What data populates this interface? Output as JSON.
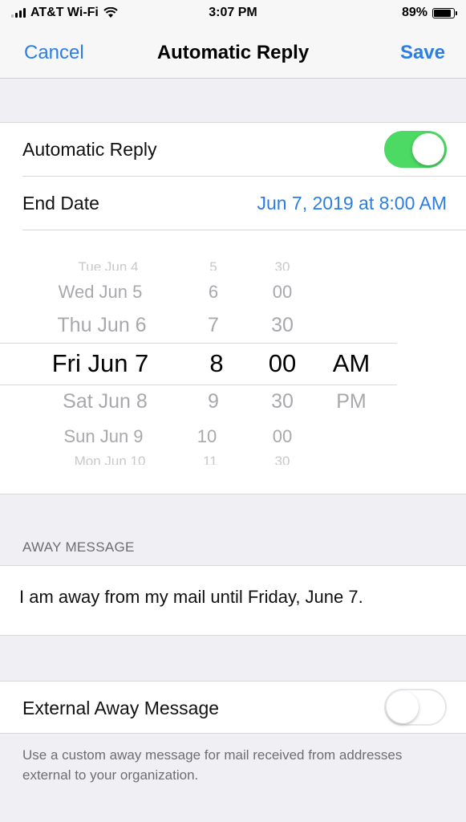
{
  "status_bar": {
    "carrier": "AT&T Wi-Fi",
    "time": "3:07 PM",
    "battery": "89%",
    "battery_level": 0.89
  },
  "nav": {
    "cancel_label": "Cancel",
    "title": "Automatic Reply",
    "save_label": "Save"
  },
  "settings": {
    "automatic_reply_label": "Automatic Reply",
    "automatic_reply_on": true,
    "end_date_label": "End Date",
    "end_date_value": "Jun 7, 2019 at 8:00 AM"
  },
  "picker": {
    "dates": [
      "Tue Jun 4",
      "Wed Jun 5",
      "Thu Jun 6",
      "Fri Jun 7",
      "Sat Jun 8",
      "Sun Jun 9",
      "Mon Jun 10"
    ],
    "hours": [
      "5",
      "6",
      "7",
      "8",
      "9",
      "10",
      "11"
    ],
    "minutes": [
      "30",
      "00",
      "30",
      "00",
      "30",
      "00",
      "30"
    ],
    "periods": [
      "AM",
      "PM"
    ]
  },
  "away_message": {
    "section_header": "AWAY MESSAGE",
    "text": "I am away from my mail until Friday, June 7."
  },
  "external": {
    "label": "External Away Message",
    "on": false,
    "note": "Use a custom away message for mail received from addresses external to your organization."
  },
  "colors": {
    "accent": "#2a7ee6",
    "toggle_on": "#4cd964"
  }
}
